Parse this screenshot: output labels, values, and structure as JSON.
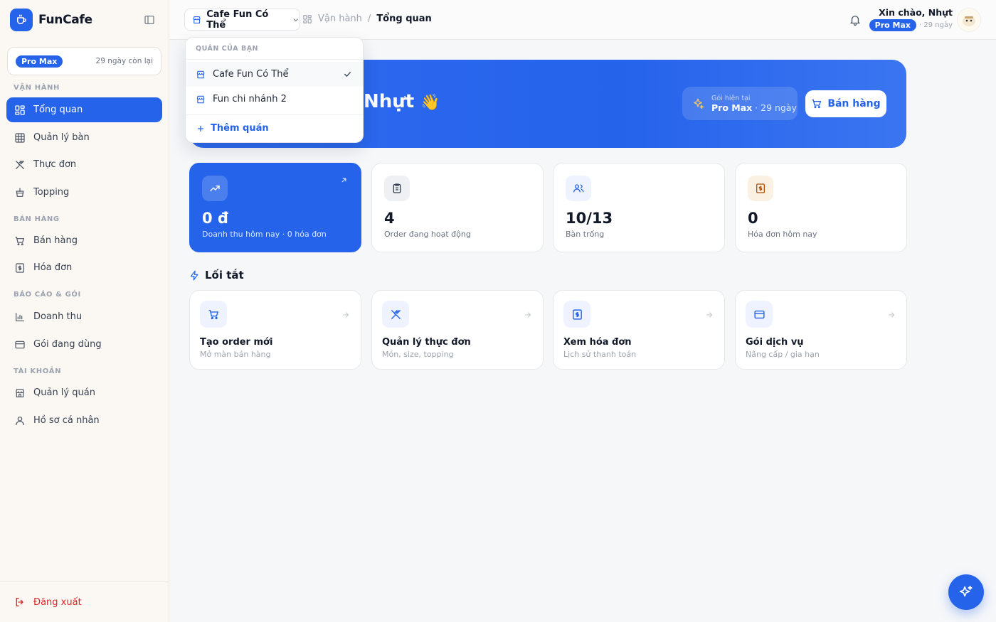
{
  "brand": {
    "name": "FunCafe"
  },
  "plan_card": {
    "plan": "Pro Max",
    "days": "29 ngày còn lại"
  },
  "sidebar": {
    "sections": [
      "VẬN HÀNH",
      "BÁN HÀNG",
      "BÁO CÁO & GÓI",
      "TÀI KHOẢN"
    ],
    "items": [
      "Tổng quan",
      "Quản lý bàn",
      "Thực đơn",
      "Topping",
      "Bán hàng",
      "Hóa đơn",
      "Doanh thu",
      "Gói đang dùng",
      "Quản lý quán",
      "Hồ sơ cá nhân"
    ],
    "logout": "Đăng xuất"
  },
  "topbar": {
    "shop": "Cafe Fun Có Thể",
    "breadcrumb": {
      "parent": "Vận hành",
      "sep": "/",
      "current": "Tổng quan"
    },
    "hello": "Xin chào, Nhựt",
    "plan": "Pro Max",
    "days": "· 29 ngày"
  },
  "dropdown": {
    "header": "QUÁN CỦA BẠN",
    "items": [
      "Cafe Fun Có Thể",
      "Fun chi nhánh 2"
    ],
    "add": "Thêm quán"
  },
  "hero": {
    "name": "Nhựt",
    "emoji": "👋",
    "plan_label": "Gói hiện tại",
    "plan_name": "Pro Max",
    "plan_days": " · 29 ngày",
    "cta": "Bán hàng"
  },
  "stats": [
    {
      "value": "0 đ",
      "label": "Doanh thu hôm nay · 0 hóa đơn"
    },
    {
      "value": "4",
      "label": "Order đang hoạt động"
    },
    {
      "value": "10/13",
      "label": "Bàn trống"
    },
    {
      "value": "0",
      "label": "Hóa đơn hôm nay"
    }
  ],
  "shortcuts": {
    "title": "Lối tắt",
    "items": [
      {
        "title": "Tạo order mới",
        "sub": "Mở màn bán hàng"
      },
      {
        "title": "Quản lý thực đơn",
        "sub": "Món, size, topping"
      },
      {
        "title": "Xem hóa đơn",
        "sub": "Lịch sử thanh toán"
      },
      {
        "title": "Gói dịch vụ",
        "sub": "Nâng cấp / gia hạn"
      }
    ]
  },
  "colors": {
    "accent": "#2563eb",
    "danger": "#dc2626"
  }
}
